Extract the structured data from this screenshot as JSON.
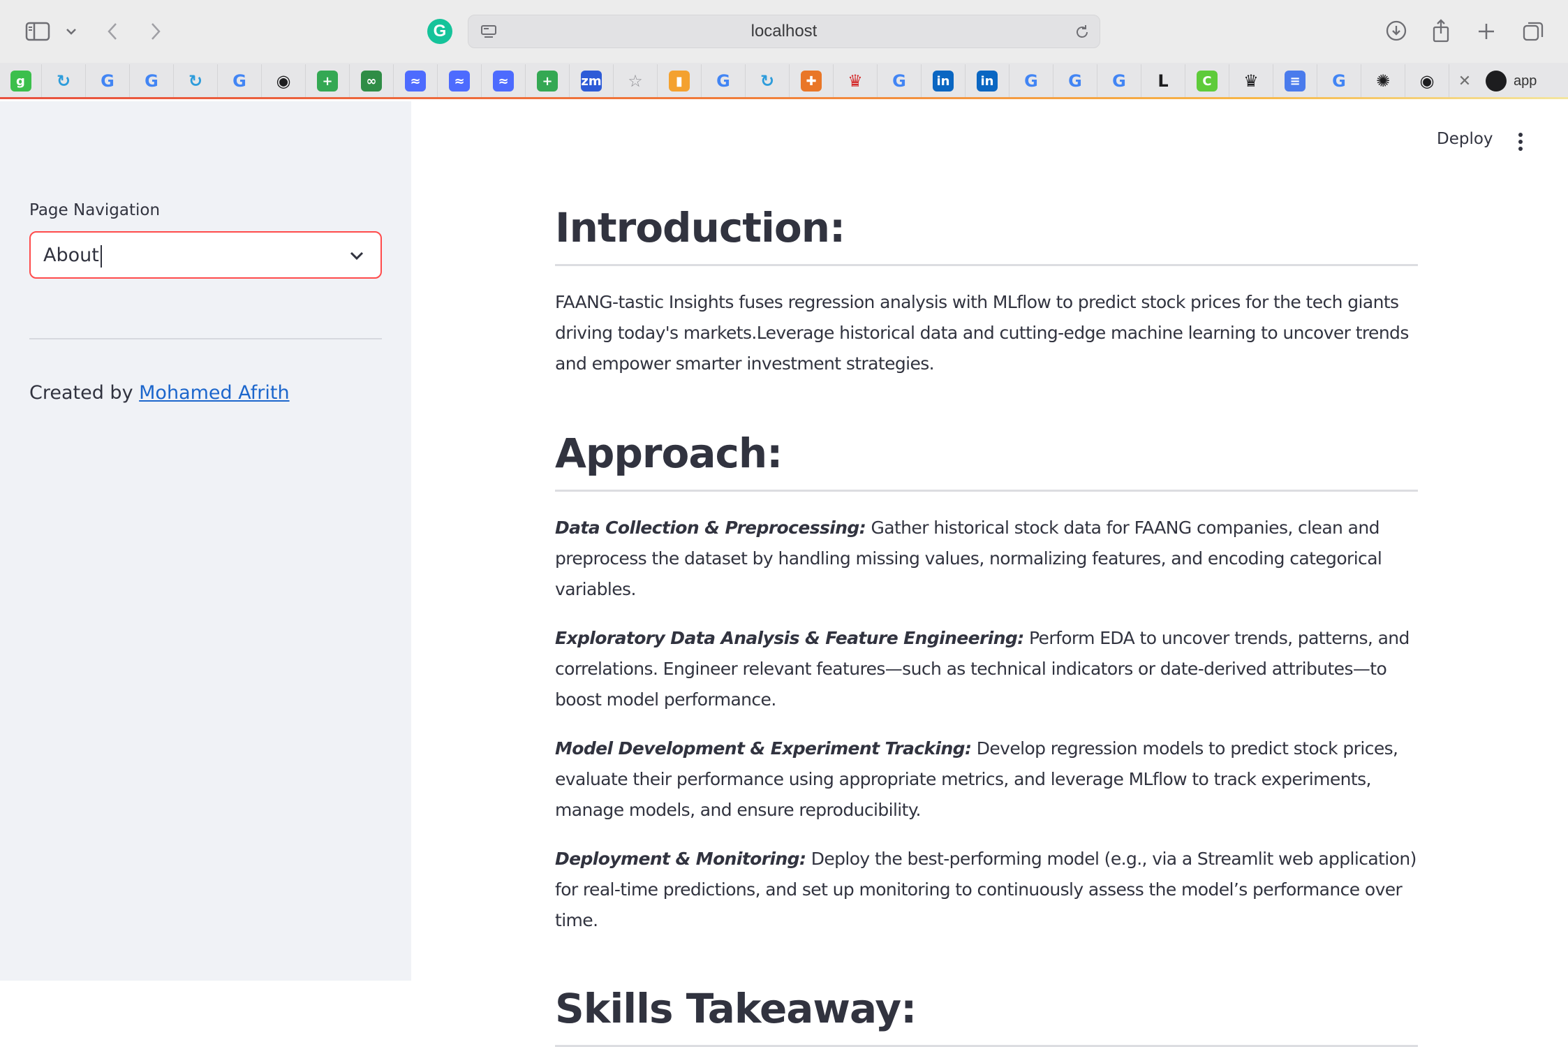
{
  "browser": {
    "address": "localhost",
    "bookmarks": [
      {
        "icon": "gitbook-icon",
        "glyph": "g",
        "color": "#3bbf4c"
      },
      {
        "icon": "refresh-sync-icon",
        "glyph": "↻",
        "color": "#2d9cdb"
      },
      {
        "icon": "google-icon",
        "glyph": "G",
        "color": "#4285f4"
      },
      {
        "icon": "google-icon",
        "glyph": "G",
        "color": "#4285f4"
      },
      {
        "icon": "refresh-sync-icon",
        "glyph": "↻",
        "color": "#2d9cdb"
      },
      {
        "icon": "google-icon",
        "glyph": "G",
        "color": "#4285f4"
      },
      {
        "icon": "github-icon",
        "glyph": "◉",
        "color": "#1d1d1f"
      },
      {
        "icon": "sheets-plus-icon",
        "glyph": "+",
        "color": "#34a853"
      },
      {
        "icon": "geeksforgeeks-icon",
        "glyph": "∞",
        "color": "#2f8d46"
      },
      {
        "icon": "whale-icon",
        "glyph": "≈",
        "color": "#4d6bfe"
      },
      {
        "icon": "whale-icon",
        "glyph": "≈",
        "color": "#4d6bfe"
      },
      {
        "icon": "whale-icon",
        "glyph": "≈",
        "color": "#4d6bfe"
      },
      {
        "icon": "sheets-plus-icon",
        "glyph": "+",
        "color": "#34a853"
      },
      {
        "icon": "zoom-icon",
        "glyph": "zm",
        "color": "#2d5bd7"
      },
      {
        "icon": "star-icon",
        "glyph": "☆",
        "color": "#8e8e93"
      },
      {
        "icon": "analytics-icon",
        "glyph": "▮",
        "color": "#f4a12f"
      },
      {
        "icon": "google-icon",
        "glyph": "G",
        "color": "#4285f4"
      },
      {
        "icon": "refresh-sync-icon",
        "glyph": "↻",
        "color": "#2d9cdb"
      },
      {
        "icon": "tableau-icon",
        "glyph": "✚",
        "color": "#e97627"
      },
      {
        "icon": "crown-icon",
        "glyph": "♛",
        "color": "#d42a2a"
      },
      {
        "icon": "google-icon",
        "glyph": "G",
        "color": "#4285f4"
      },
      {
        "icon": "linkedin-icon",
        "glyph": "in",
        "color": "#0a66c2"
      },
      {
        "icon": "linkedin-icon",
        "glyph": "in",
        "color": "#0a66c2"
      },
      {
        "icon": "google-icon",
        "glyph": "G",
        "color": "#4285f4"
      },
      {
        "icon": "google-icon",
        "glyph": "G",
        "color": "#4285f4"
      },
      {
        "icon": "google-icon",
        "glyph": "G",
        "color": "#4285f4"
      },
      {
        "icon": "letter-l-icon",
        "glyph": "L",
        "color": "#1d1d1f"
      },
      {
        "icon": "green-c-icon",
        "glyph": "C",
        "color": "#5ecb3a"
      },
      {
        "icon": "crown-dark-icon",
        "glyph": "♛",
        "color": "#1d1d1f"
      },
      {
        "icon": "docs-icon",
        "glyph": "≡",
        "color": "#4a7bec"
      },
      {
        "icon": "google-icon",
        "glyph": "G",
        "color": "#4285f4"
      },
      {
        "icon": "chatgpt-icon",
        "glyph": "✺",
        "color": "#1d1d1f"
      },
      {
        "icon": "github-icon",
        "glyph": "◉",
        "color": "#1d1d1f"
      }
    ],
    "active_tab": "app"
  },
  "sidebar": {
    "nav_label": "Page Navigation",
    "selected_page": "About",
    "created_prefix": "Created by ",
    "author": "Mohamed Afrith",
    "accent": "#ff4b4b"
  },
  "header": {
    "deploy_label": "Deploy"
  },
  "content": {
    "intro_title": "Introduction:",
    "intro_text": "FAANG-tastic Insights fuses regression analysis with MLflow to predict stock prices for the tech giants driving today's markets.Leverage historical data and cutting-edge machine learning to uncover trends and empower smarter investment strategies.",
    "approach_title": "Approach:",
    "approach_items": [
      {
        "heading": "Data Collection & Preprocessing:",
        "text": " Gather historical stock data for FAANG companies, clean and preprocess the dataset by handling missing values, normalizing features, and encoding categorical variables."
      },
      {
        "heading": "Exploratory Data Analysis & Feature Engineering:",
        "text": " Perform EDA to uncover trends, patterns, and correlations. Engineer relevant features—such as technical indicators or date-derived attributes—to boost model performance."
      },
      {
        "heading": "Model Development & Experiment Tracking:",
        "text": " Develop regression models to predict stock prices, evaluate their performance using appropriate metrics, and leverage MLflow to track experiments, manage models, and ensure reproducibility."
      },
      {
        "heading": "Deployment & Monitoring:",
        "text": " Deploy the best-performing model (e.g., via a Streamlit web application) for real-time predictions, and set up monitoring to continuously assess the model’s performance over time."
      }
    ],
    "skills_title": "Skills Takeaway:"
  }
}
